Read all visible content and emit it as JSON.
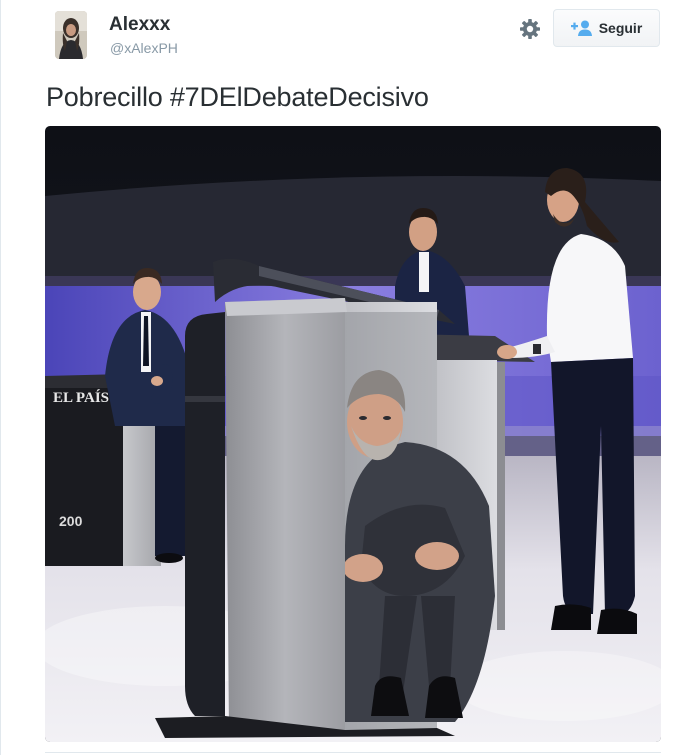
{
  "tweet": {
    "author": {
      "name": "Alexxx",
      "handle": "@xAlexPH"
    },
    "follow_button": {
      "label": "Seguir",
      "icon": "add-person-icon"
    },
    "settings_icon": "gear-icon",
    "text": "Pobrecillo #7DElDebateDecisivo",
    "media": {
      "type": "photo",
      "visible_text": [
        "EL PAÍS",
        "200"
      ]
    }
  },
  "colors": {
    "text_primary": "#292f33",
    "text_secondary": "#8899a6",
    "accent_blue": "#55acee",
    "icon_gray": "#66757f",
    "border": "#e1e8ed",
    "stage_purple": "#7a6fd0"
  }
}
